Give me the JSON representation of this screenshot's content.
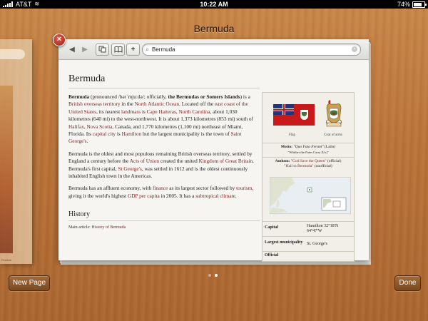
{
  "status_bar": {
    "carrier": "AT&T",
    "time": "10:22 AM",
    "battery": "74%"
  },
  "title": "Bermuda",
  "ghost_card": {
    "caption": "Festival"
  },
  "toolbar": {
    "back": "◀",
    "forward": "▶",
    "tabs_icon": "tabs-icon",
    "bookmarks_icon": "book-icon",
    "add": "+",
    "search_value": "Bermuda"
  },
  "article": {
    "heading": "Bermuda",
    "p1": {
      "t1": "Bermuda",
      "t2": " (pronounced /bərˈmjuːdə/; officially, ",
      "t3": "the Bermudas or Somers Islands",
      "t4": ") is a ",
      "l1": "British overseas territory",
      "t5": " in the ",
      "l2": "North Atlantic Ocean",
      "t6": ". Located off the ",
      "l3": "east coast of the United States",
      "t7": ", its nearest ",
      "l4": "landmass",
      "t8": " is ",
      "l5": "Cape Hatteras",
      "t9": ", ",
      "l6": "North Carolina",
      "t10": ", about 1,030 kilometres (640 mi) to the west-northwest. It is about 1,373 kilometres (853 mi) south of ",
      "l7": "Halifax",
      "t11": ", ",
      "l8": "Nova Scotia",
      "t12": ", Canada, and 1,770 kilometres (1,100 mi) northeast of Miami, Florida. Its ",
      "l9": "capital city",
      "t13": " is ",
      "l10": "Hamilton",
      "t14": " but the largest municipality is the town of ",
      "l11": "Saint George's",
      "t15": "."
    },
    "p2": {
      "t1": "Bermuda is the oldest and most populous remaining British overseas territory, settled by England a century before the ",
      "l1": "Acts of Union",
      "t2": " created the united ",
      "l2": "Kingdom of Great Britain",
      "t3": ". Bermuda's first capital, ",
      "l3": "St George's",
      "t4": ", was settled in 1612 and is the oldest continuously inhabited English town in the Americas."
    },
    "p3": {
      "t1": "Bermuda has an affluent economy, with ",
      "l1": "finance",
      "t2": " as its largest sector followed by ",
      "l2": "tourism",
      "t3": ", giving it the world's highest ",
      "l3": "GDP per capita",
      "t4": " in 2005. It has a ",
      "l4": "subtropical climate",
      "t5": "."
    },
    "history_heading": "History",
    "main_article_prefix": "Main article: ",
    "main_article_link": "History of Bermuda"
  },
  "infobox": {
    "flag_caption": "Flag",
    "coat_caption": "Coat of arms",
    "motto_label": "Motto:",
    "motto_value": "\"Quo Fata Ferunt\"",
    "motto_lang": "(Latin)",
    "motto_translation": "\"Whither the Fates Carry [Us]\"",
    "anthem_label": "Anthem:",
    "anthem_value": "\"God Save the Queen\"",
    "anthem_note": "(official)",
    "anthem2": "\"Hail to Bermuda\"",
    "anthem2_note": "(unofficial)",
    "rows": [
      {
        "key": "Capital",
        "value": "Hamilton 32°18′N 64°47′W"
      },
      {
        "key": "Largest municipality",
        "value": "St. George's"
      },
      {
        "key": "Official",
        "value": ""
      }
    ]
  },
  "page_dots": {
    "count": 2,
    "active": 1
  },
  "buttons": {
    "new_page": "New Page",
    "done": "Done"
  }
}
